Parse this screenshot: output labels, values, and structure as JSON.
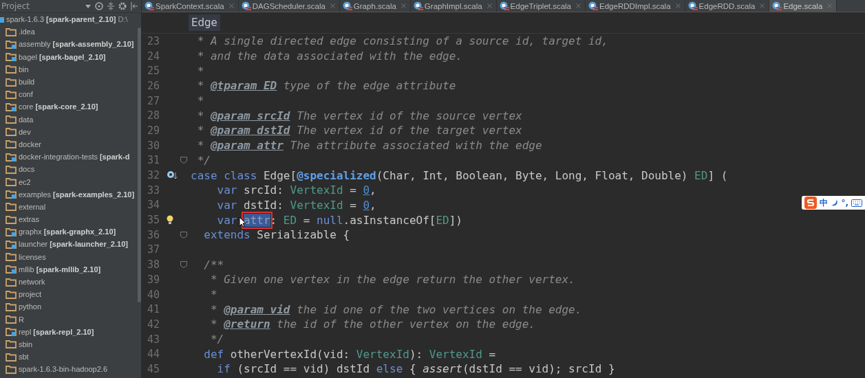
{
  "project_panel": {
    "title": "Project",
    "root": {
      "name": "spark-1.6.3",
      "module": "[spark-parent_2.10]",
      "path": "D:\\",
      "children": [
        {
          "name": ".idea"
        },
        {
          "name": "assembly",
          "module": "[spark-assembly_2.10]"
        },
        {
          "name": "bagel",
          "module": "[spark-bagel_2.10]"
        },
        {
          "name": "bin"
        },
        {
          "name": "build"
        },
        {
          "name": "conf"
        },
        {
          "name": "core",
          "module": "[spark-core_2.10]"
        },
        {
          "name": "data"
        },
        {
          "name": "dev"
        },
        {
          "name": "docker"
        },
        {
          "name": "docker-integration-tests",
          "module": "[spark-d"
        },
        {
          "name": "docs"
        },
        {
          "name": "ec2"
        },
        {
          "name": "examples",
          "module": "[spark-examples_2.10]"
        },
        {
          "name": "external"
        },
        {
          "name": "extras"
        },
        {
          "name": "graphx",
          "module": "[spark-graphx_2.10]"
        },
        {
          "name": "launcher",
          "module": "[spark-launcher_2.10]"
        },
        {
          "name": "licenses"
        },
        {
          "name": "mllib",
          "module": "[spark-mllib_2.10]"
        },
        {
          "name": "network"
        },
        {
          "name": "project"
        },
        {
          "name": "python"
        },
        {
          "name": "R"
        },
        {
          "name": "repl",
          "module": "[spark-repl_2.10]"
        },
        {
          "name": "sbin"
        },
        {
          "name": "sbt"
        },
        {
          "name": "spark-1.6.3-bin-hadoop2.6"
        }
      ]
    }
  },
  "tabs": [
    {
      "label": "SparkContext.scala",
      "selected": false
    },
    {
      "label": "DAGScheduler.scala",
      "selected": false
    },
    {
      "label": "Graph.scala",
      "selected": false
    },
    {
      "label": "GraphImpl.scala",
      "selected": false
    },
    {
      "label": "EdgeTriplet.scala",
      "selected": false
    },
    {
      "label": "EdgeRDDImpl.scala",
      "selected": false
    },
    {
      "label": "EdgeRDD.scala",
      "selected": false
    },
    {
      "label": "Edge.scala",
      "selected": true
    }
  ],
  "breadcrumb": "Edge",
  "code": [
    {
      "n": "23",
      "tokens": [
        {
          "kind": "doc",
          "text": " * A single directed edge consisting of a source id, target id,"
        }
      ]
    },
    {
      "n": "24",
      "tokens": [
        {
          "kind": "doc",
          "text": " * and the data associated with the edge."
        }
      ]
    },
    {
      "n": "25",
      "tokens": [
        {
          "kind": "doc",
          "text": " *"
        }
      ]
    },
    {
      "n": "26",
      "tokens": [
        {
          "kind": "doc",
          "text": " * "
        },
        {
          "kind": "tag",
          "text": "@tparam"
        },
        {
          "kind": "tag",
          "text": " ED"
        },
        {
          "kind": "doc",
          "text": " type of the edge attribute"
        }
      ]
    },
    {
      "n": "27",
      "tokens": [
        {
          "kind": "doc",
          "text": " *"
        }
      ]
    },
    {
      "n": "28",
      "tokens": [
        {
          "kind": "doc",
          "text": " * "
        },
        {
          "kind": "tag",
          "text": "@param"
        },
        {
          "kind": "tag",
          "text": " srcId"
        },
        {
          "kind": "doc",
          "text": " The vertex id of the source vertex"
        }
      ]
    },
    {
      "n": "29",
      "tokens": [
        {
          "kind": "doc",
          "text": " * "
        },
        {
          "kind": "tag",
          "text": "@param"
        },
        {
          "kind": "tag",
          "text": " dstId"
        },
        {
          "kind": "doc",
          "text": " The vertex id of the target vertex"
        }
      ]
    },
    {
      "n": "30",
      "tokens": [
        {
          "kind": "doc",
          "text": " * "
        },
        {
          "kind": "tag",
          "text": "@param"
        },
        {
          "kind": "tag",
          "text": " attr"
        },
        {
          "kind": "doc",
          "text": " The attribute associated with the edge"
        }
      ]
    },
    {
      "n": "31",
      "fold": true,
      "tokens": [
        {
          "kind": "doc",
          "text": " */"
        }
      ]
    },
    {
      "n": "32",
      "override_marker": true,
      "tokens": [
        {
          "kind": "kw",
          "text": "case class "
        },
        {
          "kind": "plain",
          "text": "Edge["
        },
        {
          "kind": "ann",
          "text": "@specialized"
        },
        {
          "kind": "plain",
          "text": "(Char, Int, Boolean, Byte, Long, Float, Double) "
        },
        {
          "kind": "type",
          "text": "ED"
        },
        {
          "kind": "plain",
          "text": "] ("
        }
      ]
    },
    {
      "n": "33",
      "tokens": [
        {
          "kind": "kw",
          "text": "    var "
        },
        {
          "kind": "plain",
          "text": "srcId: "
        },
        {
          "kind": "type",
          "text": "VertexId"
        },
        {
          "kind": "plain",
          "text": " = "
        },
        {
          "kind": "num",
          "text": "0"
        },
        {
          "kind": "plain",
          "text": ","
        }
      ]
    },
    {
      "n": "34",
      "tokens": [
        {
          "kind": "kw",
          "text": "    var "
        },
        {
          "kind": "plain",
          "text": "dstId: "
        },
        {
          "kind": "type",
          "text": "VertexId"
        },
        {
          "kind": "plain",
          "text": " = "
        },
        {
          "kind": "num",
          "text": "0"
        },
        {
          "kind": "plain",
          "text": ","
        }
      ]
    },
    {
      "n": "35",
      "intention_bulb": true,
      "tokens": [
        {
          "kind": "kw",
          "text": "    var "
        },
        {
          "kind": "marked",
          "text": "attr"
        },
        {
          "kind": "plain",
          "text": ": "
        },
        {
          "kind": "type",
          "text": "ED"
        },
        {
          "kind": "plain",
          "text": " = "
        },
        {
          "kind": "kw",
          "text": "null"
        },
        {
          "kind": "plain",
          "text": ".asInstanceOf["
        },
        {
          "kind": "type",
          "text": "ED"
        },
        {
          "kind": "plain",
          "text": "])"
        }
      ]
    },
    {
      "n": "36",
      "fold": true,
      "tokens": [
        {
          "kind": "kw",
          "text": "  extends "
        },
        {
          "kind": "plain",
          "text": "Serializable {"
        }
      ]
    },
    {
      "n": "37"
    },
    {
      "n": "38",
      "fold": true,
      "tokens": [
        {
          "kind": "doc",
          "text": "  /**"
        }
      ]
    },
    {
      "n": "39",
      "tokens": [
        {
          "kind": "doc",
          "text": "   * Given one vertex in the edge return the other vertex."
        }
      ]
    },
    {
      "n": "40",
      "tokens": [
        {
          "kind": "doc",
          "text": "   *"
        }
      ]
    },
    {
      "n": "41",
      "tokens": [
        {
          "kind": "doc",
          "text": "   * "
        },
        {
          "kind": "tag",
          "text": "@param"
        },
        {
          "kind": "tag",
          "text": " vid"
        },
        {
          "kind": "doc",
          "text": " the id one of the two vertices on the edge."
        }
      ]
    },
    {
      "n": "42",
      "tokens": [
        {
          "kind": "doc",
          "text": "   * "
        },
        {
          "kind": "tag",
          "text": "@return"
        },
        {
          "kind": "doc",
          "text": " the id of the other vertex on the edge."
        }
      ]
    },
    {
      "n": "43",
      "tokens": [
        {
          "kind": "doc",
          "text": "   */"
        }
      ]
    },
    {
      "n": "44",
      "tokens": [
        {
          "kind": "kw",
          "text": "  def "
        },
        {
          "kind": "plain",
          "text": "otherVertexId(vid: "
        },
        {
          "kind": "type",
          "text": "VertexId"
        },
        {
          "kind": "plain",
          "text": "): "
        },
        {
          "kind": "type",
          "text": "VertexId"
        },
        {
          "kind": "plain",
          "text": " ="
        }
      ]
    },
    {
      "n": "45",
      "tokens": [
        {
          "kind": "kw",
          "text": "    if "
        },
        {
          "kind": "plain",
          "text": "(srcId == vid) dstId "
        },
        {
          "kind": "kw",
          "text": "else "
        },
        {
          "kind": "plain",
          "text": "{ "
        },
        {
          "kind": "italic",
          "text": "assert"
        },
        {
          "kind": "plain",
          "text": "(dstId == vid); srcId }"
        }
      ]
    }
  ],
  "ime_toolbar": {
    "mode": "中",
    "punctuation": "°,"
  }
}
